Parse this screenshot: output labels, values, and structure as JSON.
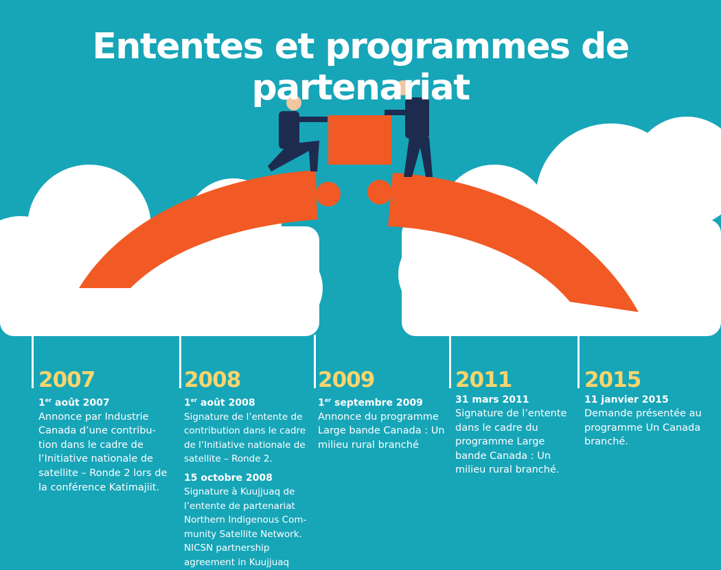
{
  "title": "Ententes et programmes de partenariat",
  "colors": {
    "background": "#17a5b8",
    "year": "#f8d56d",
    "puzzle": "#f15a24",
    "suit": "#1d2b4f"
  },
  "timeline": [
    {
      "year": "2007",
      "events": [
        {
          "date_day": "1",
          "date_sup": "er",
          "date_rest": " août 2007",
          "text": "Annonce par Industrie Canada d’une contribu-tion dans le cadre de l’Initiative nationale de satellite – Ronde 2 lors de la conférence Katimajiit."
        }
      ]
    },
    {
      "year": "2008",
      "events": [
        {
          "date_day": "1",
          "date_sup": "er",
          "date_rest": " août 2008",
          "text": "Signature de l’entente de contribution dans le cadre de l’Initiative nationale de satellite – Ronde 2."
        },
        {
          "date_day": "15 octobre 2008",
          "date_sup": "",
          "date_rest": "",
          "text": "Signature à Kuujjuaq de l’entente de partenariat Northern Indigenous Com-munity Satellite Network. NICSN partnership agreement in Kuujjuaq"
        }
      ]
    },
    {
      "year": "2009",
      "events": [
        {
          "date_day": "1",
          "date_sup": "er",
          "date_rest": " septembre 2009",
          "text": "Annonce du programme Large bande Canada : Un milieu rural branché"
        }
      ]
    },
    {
      "year": "2011",
      "events": [
        {
          "date_day": "31 mars 2011",
          "date_sup": "",
          "date_rest": "",
          "text": "Signature de l’entente dans le cadre du programme Large bande Canada : Un milieu rural branché."
        }
      ]
    },
    {
      "year": "2015",
      "events": [
        {
          "date_day": "11 janvier 2015",
          "date_sup": "",
          "date_rest": "",
          "text": "Demande présentée au programme Un Canada branché."
        }
      ]
    }
  ]
}
